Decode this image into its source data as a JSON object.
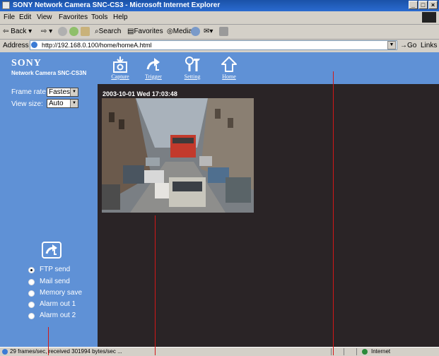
{
  "window": {
    "title": "SONY Network Camera SNC-CS3 - Microsoft Internet Explorer"
  },
  "menu": [
    "File",
    "Edit",
    "View",
    "Favorites",
    "Tools",
    "Help"
  ],
  "toolbar": {
    "back": "Back",
    "search": "Search",
    "favorites": "Favorites",
    "media": "Media"
  },
  "address": {
    "label": "Address",
    "url": "http://192.168.0.100/home/homeA.html",
    "go": "Go",
    "links": "Links"
  },
  "brand": {
    "logo": "SONY",
    "model": "Network Camera SNC-CS3N"
  },
  "controls": {
    "frame_rate_label": "Frame rate",
    "frame_rate_value": "Fastest",
    "view_size_label": "View size:",
    "view_size_value": "Auto"
  },
  "nav": [
    {
      "label": "Capture",
      "icon": "capture-icon"
    },
    {
      "label": "Trigger",
      "icon": "trigger-icon"
    },
    {
      "label": "Setting",
      "icon": "setting-icon"
    },
    {
      "label": "Home",
      "icon": "home-icon"
    }
  ],
  "camera": {
    "timestamp": "2003-10-01 Wed  17:03:48"
  },
  "trigger_options": [
    {
      "label": "FTP send",
      "selected": true
    },
    {
      "label": "Mail send",
      "selected": false
    },
    {
      "label": "Memory save",
      "selected": false
    },
    {
      "label": "Alarm out 1",
      "selected": false
    },
    {
      "label": "Alarm out 2",
      "selected": false
    }
  ],
  "status": {
    "text": "29 frames/sec, received 301994 bytes/sec ...",
    "zone": "Internet"
  },
  "colors": {
    "panel_blue": "#5f91d6",
    "viewer_dark": "#2a2426",
    "callout_red": "#d21818",
    "titlebar_blue": "#1a52a8"
  }
}
